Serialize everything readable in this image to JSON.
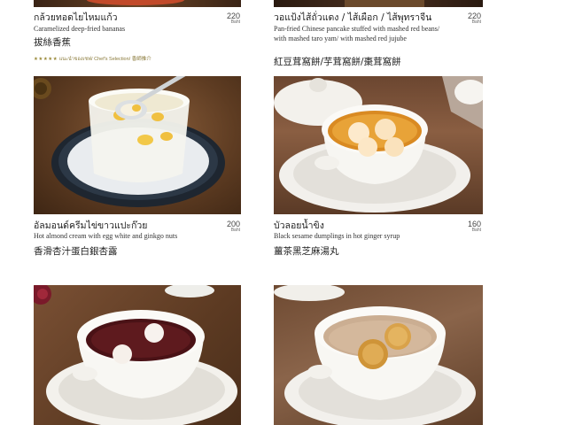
{
  "items": [
    {
      "name_th": "กล้วยทอดไยไหมแก้ว",
      "name_en": "Caramelized deep-fried bananas",
      "name_cn": "拔絲香蕉",
      "price": "220",
      "currency": "Baht",
      "chef_stars": "★★★★★",
      "chef_label": "แนะนำของเชฟ/ Chef's Selection/ 香師推介"
    },
    {
      "name_th": "วอแป้งไส้ถั่วแดง / ไส้เผือก / ไส้พุทราจีน",
      "name_en": "Pan-fried Chinese pancake stuffed with mashed red beans/ with mashed taro yam/ with mashed red jujube",
      "name_cn": "紅豆茸窩餅/芋茸窩餅/棗茸窩餅",
      "price": "220",
      "currency": "Baht"
    },
    {
      "name_th": "อัลมอนด์ครีมไข่ขาวแปะก๊วย",
      "name_en": "Hot almond cream with egg white and ginkgo nuts",
      "name_cn": "香滑杏汁蛋白銀杏露",
      "price": "200",
      "currency": "Baht"
    },
    {
      "name_th": "บัวลอยน้ำขิง",
      "name_en": "Black sesame dumplings in hot ginger syrup",
      "name_cn": "薑茶黑芝麻湯丸",
      "price": "160",
      "currency": "Baht"
    },
    {
      "image": "red-bean-soup-with-dumplings-photo"
    },
    {
      "image": "sweet-soup-with-sesame-balls-photo"
    }
  ],
  "colors": {
    "wood_dark": "#5a3a22",
    "wood_mid": "#7a4e2e",
    "bowl": "#f7f5f0",
    "accent_gold": "#8a7a3a"
  }
}
